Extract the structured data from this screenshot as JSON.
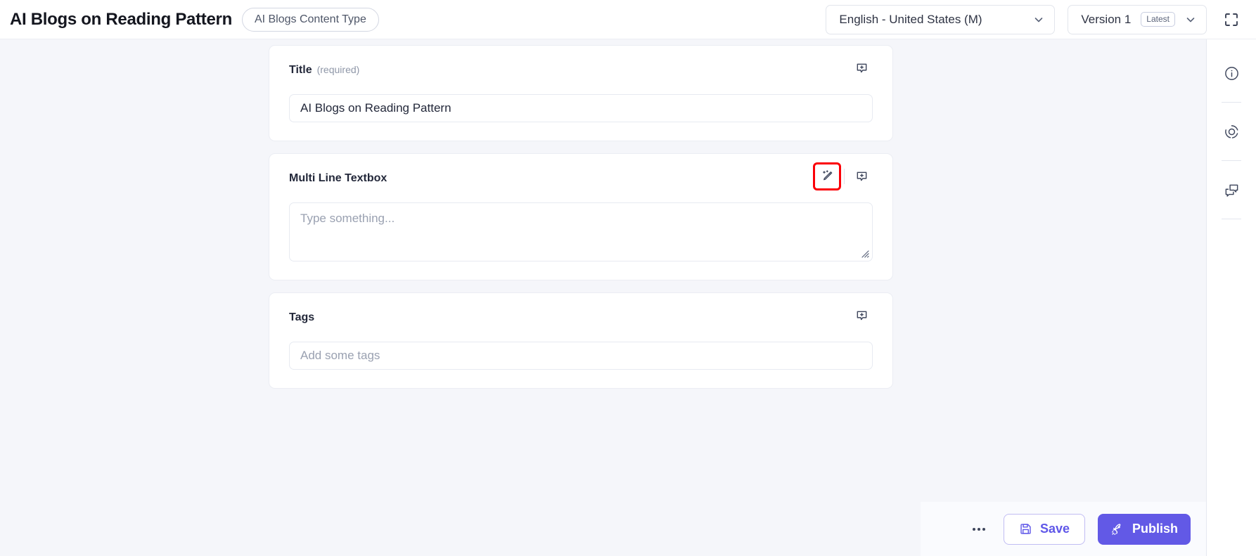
{
  "header": {
    "title": "AI Blogs on Reading Pattern",
    "content_type_chip": "AI Blogs Content Type",
    "language_select": "English - United States (M)",
    "version_select": "Version 1",
    "version_badge": "Latest",
    "fullscreen_icon": "fullscreen-expand-icon"
  },
  "fields": [
    {
      "key": "title",
      "label": "Title",
      "required_text": "(required)",
      "input_type": "text",
      "value": "AI Blogs on Reading Pattern",
      "placeholder": "",
      "has_ai_assist": false,
      "comment_icon": "add-comment-icon"
    },
    {
      "key": "multi_line_textbox",
      "label": "Multi Line Textbox",
      "required_text": "",
      "input_type": "textarea",
      "value": "",
      "placeholder": "Type something...",
      "has_ai_assist": true,
      "ai_assist_icon": "magic-wand-pen-icon",
      "ai_assist_highlighted": true,
      "comment_icon": "add-comment-icon",
      "resize_handle": "resize-grip-icon"
    },
    {
      "key": "tags",
      "label": "Tags",
      "required_text": "",
      "input_type": "text",
      "value": "",
      "placeholder": "Add some tags",
      "has_ai_assist": false,
      "comment_icon": "add-comment-icon"
    }
  ],
  "rail": {
    "items": [
      {
        "key": "info",
        "icon": "info-circle-icon"
      },
      {
        "key": "workflow",
        "icon": "target-circle-icon"
      },
      {
        "key": "comments",
        "icon": "comments-icon"
      }
    ]
  },
  "action_bar": {
    "more_label": "More options",
    "save_label": "Save",
    "save_icon": "floppy-disk-save-icon",
    "publish_label": "Publish",
    "publish_icon": "rocket-icon"
  },
  "colors": {
    "accent_purple": "#6259e6",
    "save_text": "#5f57e8",
    "page_bg": "#f5f6fa",
    "card_bg": "#ffffff",
    "highlight_red": "#fb0007",
    "text_primary": "#23283a",
    "text_muted": "#9aa1b1"
  }
}
